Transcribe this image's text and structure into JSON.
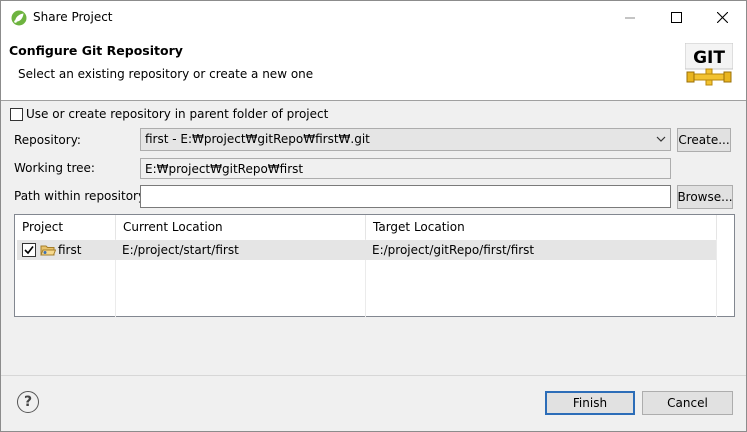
{
  "window": {
    "title": "Share Project"
  },
  "header": {
    "title": "Configure Git Repository",
    "subtitle": "Select an existing repository or create a new one",
    "logo_text": "GIT"
  },
  "parent_folder": {
    "label": "Use or create repository in parent folder of project",
    "checked": false
  },
  "repository": {
    "label": "Repository:",
    "value": "first - E:₩project₩gitRepo₩first₩.git",
    "create_label": "Create..."
  },
  "working_tree": {
    "label": "Working tree:",
    "value": "E:₩project₩gitRepo₩first"
  },
  "path_within": {
    "label": "Path within repository:",
    "value": "",
    "browse_label": "Browse..."
  },
  "table": {
    "columns": [
      "Project",
      "Current Location",
      "Target Location"
    ],
    "rows": [
      {
        "checked": true,
        "project": "first",
        "current": "E:/project/start/first",
        "target": "E:/project/gitRepo/first/first"
      }
    ]
  },
  "footer": {
    "help_symbol": "?",
    "finish_label": "Finish",
    "cancel_label": "Cancel"
  },
  "colors": {
    "accent_border": "#2c6db8",
    "selected_row": "#e5e5e5"
  }
}
